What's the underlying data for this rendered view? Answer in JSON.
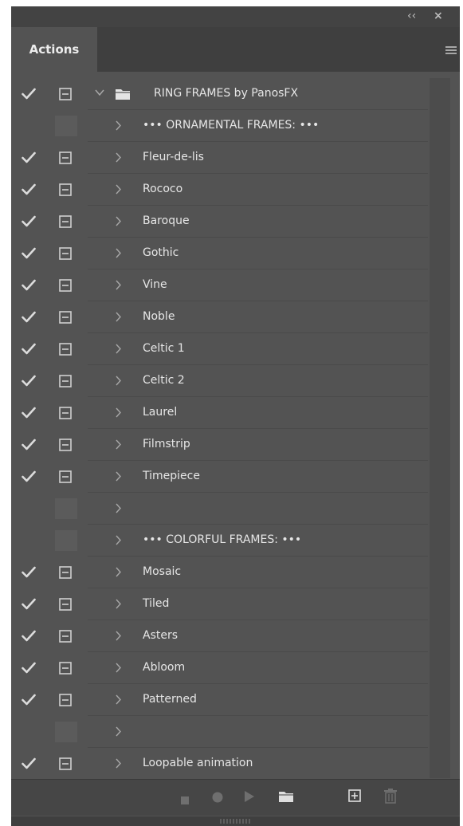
{
  "panel": {
    "tab_label": "Actions",
    "collapse_glyph": "‹‹",
    "close_glyph": "×",
    "menu_icon": "hamburger-menu-icon"
  },
  "colors": {
    "panel_bg": "#535353",
    "tab_bar_bg": "#3f3f3f",
    "text": "#e6e6e6",
    "icon": "#cfcfcf"
  },
  "action_set": {
    "name": "RING FRAMES by PanosFX",
    "checked": true,
    "dialog": true,
    "expanded": true
  },
  "actions": [
    {
      "name": "••• ORNAMENTAL FRAMES: •••",
      "checked": false,
      "dialog": false
    },
    {
      "name": "Fleur-de-lis",
      "checked": true,
      "dialog": true
    },
    {
      "name": "Rococo",
      "checked": true,
      "dialog": true
    },
    {
      "name": "Baroque",
      "checked": true,
      "dialog": true
    },
    {
      "name": "Gothic",
      "checked": true,
      "dialog": true
    },
    {
      "name": "Vine",
      "checked": true,
      "dialog": true
    },
    {
      "name": "Noble",
      "checked": true,
      "dialog": true
    },
    {
      "name": "Celtic 1",
      "checked": true,
      "dialog": true
    },
    {
      "name": "Celtic 2",
      "checked": true,
      "dialog": true
    },
    {
      "name": "Laurel",
      "checked": true,
      "dialog": true
    },
    {
      "name": "Filmstrip",
      "checked": true,
      "dialog": true
    },
    {
      "name": "Timepiece",
      "checked": true,
      "dialog": true
    },
    {
      "name": "",
      "checked": false,
      "dialog": false
    },
    {
      "name": "••• COLORFUL FRAMES: •••",
      "checked": false,
      "dialog": false
    },
    {
      "name": "Mosaic",
      "checked": true,
      "dialog": true
    },
    {
      "name": "Tiled",
      "checked": true,
      "dialog": true
    },
    {
      "name": "Asters",
      "checked": true,
      "dialog": true
    },
    {
      "name": "Abloom",
      "checked": true,
      "dialog": true
    },
    {
      "name": "Patterned",
      "checked": true,
      "dialog": true
    },
    {
      "name": "",
      "checked": false,
      "dialog": false
    },
    {
      "name": "Loopable animation",
      "checked": true,
      "dialog": true
    }
  ],
  "toolbar": [
    {
      "name": "stop-button",
      "icon": "stop-icon"
    },
    {
      "name": "record-button",
      "icon": "record-icon"
    },
    {
      "name": "play-button",
      "icon": "play-icon"
    },
    {
      "name": "new-set-button",
      "icon": "folder-icon"
    },
    {
      "name": "new-action-button",
      "icon": "new-action-icon"
    },
    {
      "name": "delete-button",
      "icon": "trash-icon"
    }
  ]
}
